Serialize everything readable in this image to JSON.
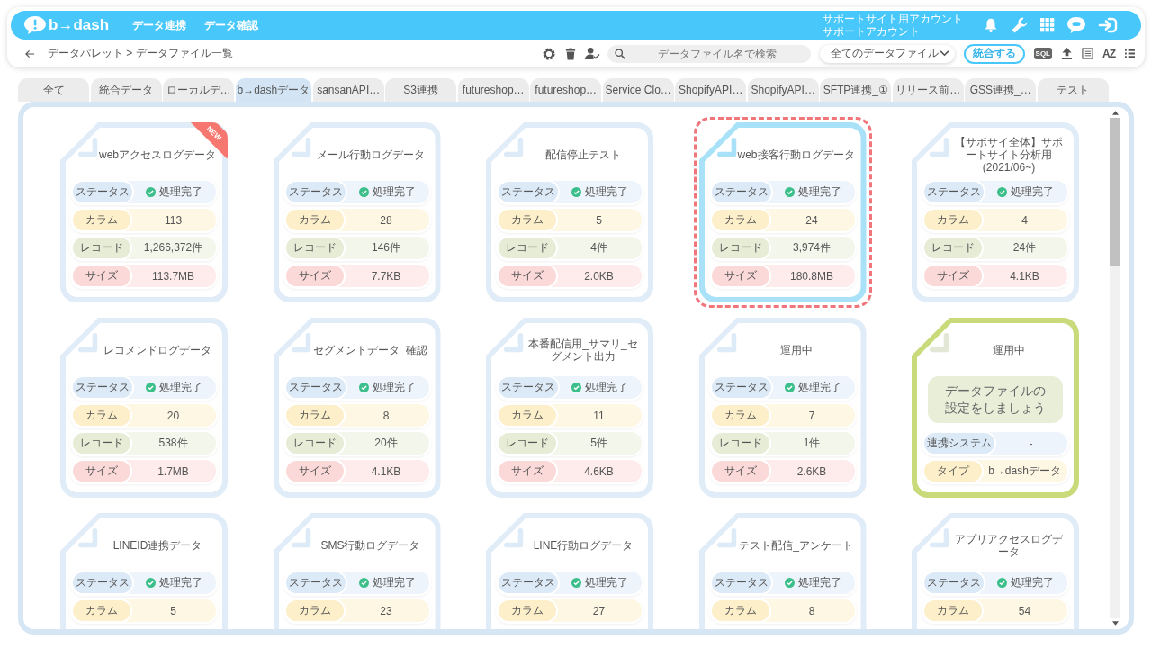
{
  "header": {
    "logo": "b→dash",
    "nav": [
      {
        "label": "データ連携"
      },
      {
        "label": "データ確認"
      }
    ],
    "account": [
      "サポートサイト用アカウント",
      "サポートアカウント"
    ]
  },
  "toolbar": {
    "breadcrumb": "データパレット > データファイル一覧",
    "search": {
      "placeholder": "データファイル名で検索"
    },
    "filter": {
      "value": "全てのデータファイル"
    },
    "merge_button": "統合する",
    "sql_label": "SQL",
    "sort_label": "AZ"
  },
  "tabs": [
    {
      "label": "全て",
      "selected": false
    },
    {
      "label": "統合データ",
      "selected": false
    },
    {
      "label": "ローカルデ…",
      "selected": false
    },
    {
      "label": "b→dashデータ",
      "selected": true
    },
    {
      "label": "sansanAPI…",
      "selected": false
    },
    {
      "label": "S3連携",
      "selected": false
    },
    {
      "label": "futureshop…",
      "selected": false
    },
    {
      "label": "futureshop…",
      "selected": false
    },
    {
      "label": "Service Clo…",
      "selected": false
    },
    {
      "label": "ShopifyAPI…",
      "selected": false
    },
    {
      "label": "ShopifyAPI…",
      "selected": false
    },
    {
      "label": "SFTP連携_①",
      "selected": false
    },
    {
      "label": "リリース前…",
      "selected": false
    },
    {
      "label": "GSS連携_…",
      "selected": false
    },
    {
      "label": "テスト",
      "selected": false
    }
  ],
  "cards": [
    {
      "kind": "file",
      "title": "webアクセスログデータ",
      "badge": "NEW",
      "selected": false,
      "rows": [
        {
          "kind": "status",
          "label": "ステータス",
          "value": "処理完了",
          "color": "#dce9f6"
        },
        {
          "kind": "text",
          "label": "カラム",
          "value": "113",
          "color": "#fcefc9"
        },
        {
          "kind": "text",
          "label": "レコード",
          "value": "1,266,372件",
          "color": "#e6ecd6"
        },
        {
          "kind": "text",
          "label": "サイズ",
          "value": "113.7MB",
          "color": "#fcd9d9"
        }
      ]
    },
    {
      "kind": "file",
      "title": "メール行動ログデータ",
      "selected": false,
      "rows": [
        {
          "kind": "status",
          "label": "ステータス",
          "value": "処理完了",
          "color": "#dce9f6"
        },
        {
          "kind": "text",
          "label": "カラム",
          "value": "28",
          "color": "#fcefc9"
        },
        {
          "kind": "text",
          "label": "レコード",
          "value": "146件",
          "color": "#e6ecd6"
        },
        {
          "kind": "text",
          "label": "サイズ",
          "value": "7.7KB",
          "color": "#fcd9d9"
        }
      ]
    },
    {
      "kind": "file",
      "title": "配信停止テスト",
      "selected": false,
      "rows": [
        {
          "kind": "status",
          "label": "ステータス",
          "value": "処理完了",
          "color": "#dce9f6"
        },
        {
          "kind": "text",
          "label": "カラム",
          "value": "5",
          "color": "#fcefc9"
        },
        {
          "kind": "text",
          "label": "レコード",
          "value": "4件",
          "color": "#e6ecd6"
        },
        {
          "kind": "text",
          "label": "サイズ",
          "value": "2.0KB",
          "color": "#fcd9d9"
        }
      ]
    },
    {
      "kind": "file",
      "title": "web接客行動ログデータ",
      "selected": true,
      "rows": [
        {
          "kind": "status",
          "label": "ステータス",
          "value": "処理完了",
          "color": "#dce9f6"
        },
        {
          "kind": "text",
          "label": "カラム",
          "value": "24",
          "color": "#fcefc9"
        },
        {
          "kind": "text",
          "label": "レコード",
          "value": "3,974件",
          "color": "#e6ecd6"
        },
        {
          "kind": "text",
          "label": "サイズ",
          "value": "180.8MB",
          "color": "#fcd9d9"
        }
      ]
    },
    {
      "kind": "file",
      "title": "【サポサイ全体】サポートサイト分析用(2021/06~)",
      "selected": false,
      "rows": [
        {
          "kind": "status",
          "label": "ステータス",
          "value": "処理完了",
          "color": "#dce9f6"
        },
        {
          "kind": "text",
          "label": "カラム",
          "value": "4",
          "color": "#fcefc9"
        },
        {
          "kind": "text",
          "label": "レコード",
          "value": "24件",
          "color": "#e6ecd6"
        },
        {
          "kind": "text",
          "label": "サイズ",
          "value": "4.1KB",
          "color": "#fcd9d9"
        }
      ]
    },
    {
      "kind": "file",
      "title": "レコメンドログデータ",
      "selected": false,
      "rows": [
        {
          "kind": "status",
          "label": "ステータス",
          "value": "処理完了",
          "color": "#dce9f6"
        },
        {
          "kind": "text",
          "label": "カラム",
          "value": "20",
          "color": "#fcefc9"
        },
        {
          "kind": "text",
          "label": "レコード",
          "value": "538件",
          "color": "#e6ecd6"
        },
        {
          "kind": "text",
          "label": "サイズ",
          "value": "1.7MB",
          "color": "#fcd9d9"
        }
      ]
    },
    {
      "kind": "file",
      "title": "セグメントデータ_確認",
      "selected": false,
      "rows": [
        {
          "kind": "status",
          "label": "ステータス",
          "value": "処理完了",
          "color": "#dce9f6"
        },
        {
          "kind": "text",
          "label": "カラム",
          "value": "8",
          "color": "#fcefc9"
        },
        {
          "kind": "text",
          "label": "レコード",
          "value": "20件",
          "color": "#e6ecd6"
        },
        {
          "kind": "text",
          "label": "サイズ",
          "value": "4.1KB",
          "color": "#fcd9d9"
        }
      ]
    },
    {
      "kind": "file",
      "title": "本番配信用_サマリ_セグメント出力",
      "selected": false,
      "rows": [
        {
          "kind": "status",
          "label": "ステータス",
          "value": "処理完了",
          "color": "#dce9f6"
        },
        {
          "kind": "text",
          "label": "カラム",
          "value": "11",
          "color": "#fcefc9"
        },
        {
          "kind": "text",
          "label": "レコード",
          "value": "5件",
          "color": "#e6ecd6"
        },
        {
          "kind": "text",
          "label": "サイズ",
          "value": "4.6KB",
          "color": "#fcd9d9"
        }
      ]
    },
    {
      "kind": "file",
      "title": "運用中",
      "selected": false,
      "rows": [
        {
          "kind": "status",
          "label": "ステータス",
          "value": "処理完了",
          "color": "#dce9f6"
        },
        {
          "kind": "text",
          "label": "カラム",
          "value": "7",
          "color": "#fcefc9"
        },
        {
          "kind": "text",
          "label": "レコード",
          "value": "1件",
          "color": "#e6ecd6"
        },
        {
          "kind": "text",
          "label": "サイズ",
          "value": "2.6KB",
          "color": "#fcd9d9"
        }
      ]
    },
    {
      "kind": "setup",
      "title": "運用中",
      "message": "データファイルの設定をしましょう",
      "selected": false,
      "rows": [
        {
          "kind": "text",
          "label": "連携システム",
          "value": "-",
          "color": "#dce9f6"
        },
        {
          "kind": "text",
          "label": "タイプ",
          "value": "b→dashデータ",
          "color": "#fcefc9"
        }
      ]
    },
    {
      "kind": "file",
      "title": "LINEID連携データ",
      "selected": false,
      "rows": [
        {
          "kind": "status",
          "label": "ステータス",
          "value": "処理完了",
          "color": "#dce9f6"
        },
        {
          "kind": "text",
          "label": "カラム",
          "value": "5",
          "color": "#fcefc9"
        }
      ]
    },
    {
      "kind": "file",
      "title": "SMS行動ログデータ",
      "selected": false,
      "rows": [
        {
          "kind": "status",
          "label": "ステータス",
          "value": "処理完了",
          "color": "#dce9f6"
        },
        {
          "kind": "text",
          "label": "カラム",
          "value": "23",
          "color": "#fcefc9"
        }
      ]
    },
    {
      "kind": "file",
      "title": "LINE行動ログデータ",
      "selected": false,
      "rows": [
        {
          "kind": "status",
          "label": "ステータス",
          "value": "処理完了",
          "color": "#dce9f6"
        },
        {
          "kind": "text",
          "label": "カラム",
          "value": "27",
          "color": "#fcefc9"
        }
      ]
    },
    {
      "kind": "file",
      "title": "テスト配信_アンケート",
      "selected": false,
      "rows": [
        {
          "kind": "status",
          "label": "ステータス",
          "value": "処理完了",
          "color": "#dce9f6"
        },
        {
          "kind": "text",
          "label": "カラム",
          "value": "8",
          "color": "#fcefc9"
        }
      ]
    },
    {
      "kind": "file",
      "title": "アプリアクセスログデータ",
      "selected": false,
      "rows": [
        {
          "kind": "status",
          "label": "ステータス",
          "value": "処理完了",
          "color": "#dce9f6"
        },
        {
          "kind": "text",
          "label": "カラム",
          "value": "54",
          "color": "#fcefc9"
        }
      ]
    }
  ]
}
